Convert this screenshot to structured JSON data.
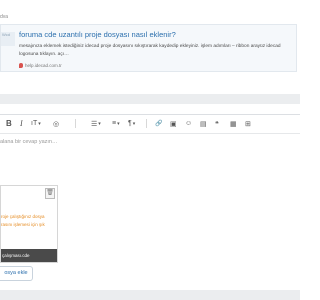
{
  "breadcrumb": {
    "text": "dva"
  },
  "link_preview": {
    "thumb_text": "Wcd",
    "title": "foruma cde uzantılı proje dosyası nasıl eklenir?",
    "description": "mesajınıza eklemek istediğiniz idecad proje dosyasını sıkıştırarak kaydedip ekleyiniz. işlem adımları – ribbon arayüz idecad logosuna tıklayın. açı…",
    "url": "help.idecad.com.tr"
  },
  "toolbar": {
    "bold": "B",
    "italic": "I",
    "font_size": "ıT",
    "font_size_caret": "▾",
    "color": "◎",
    "list": "☰",
    "list_caret": "▾",
    "align": "≡",
    "align_caret": "▾",
    "paragraph": "¶",
    "paragraph_caret": "▾",
    "link": "🔗",
    "image": "▣",
    "smilie": "☺",
    "media": "▤",
    "quote": "❝",
    "code": "▦",
    "table": "⊞"
  },
  "editor": {
    "placeholder": "alana bir cevap yazın…"
  },
  "attachment": {
    "delete_icon": "🗑",
    "text_line1": "roje çalıştığınız dosya",
    "text_line2": "rasını işlemesi için şık",
    "filename": "çalışması.cde"
  },
  "add_file": {
    "label": "osya ekle"
  }
}
